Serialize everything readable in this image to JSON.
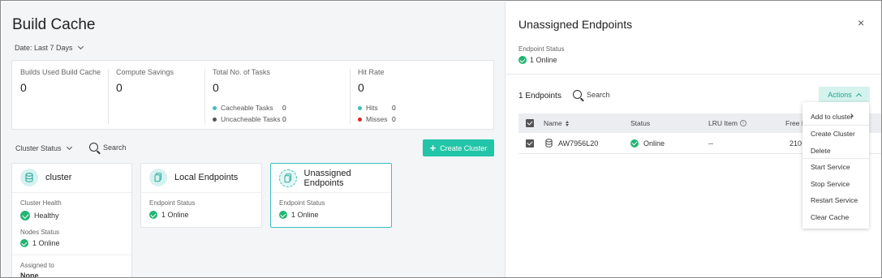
{
  "page": {
    "title": "Build Cache",
    "date_filter": "Date: Last 7 Days"
  },
  "stats": {
    "builds_used": {
      "label": "Builds Used Build Cache",
      "value": "0"
    },
    "compute_savings": {
      "label": "Compute Savings",
      "value": "0"
    },
    "total_tasks": {
      "label": "Total No. of Tasks",
      "value": "0",
      "cacheable_label": "Cacheable Tasks",
      "cacheable_value": "0",
      "uncacheable_label": "Uncacheable Tasks",
      "uncacheable_value": "0"
    },
    "hit_rate": {
      "label": "Hit Rate",
      "value": "0",
      "hits_label": "Hits",
      "hits_value": "0",
      "misses_label": "Misses",
      "misses_value": "0"
    }
  },
  "toolbar": {
    "cluster_status": "Cluster Status",
    "search": "Search",
    "create_cluster": "Create Cluster"
  },
  "tiles": {
    "cluster": {
      "title": "cluster",
      "health_label": "Cluster Health",
      "health_value": "Healthy",
      "nodes_label": "Nodes Status",
      "nodes_value": "1 Online",
      "assigned_label": "Assigned to",
      "assigned_value": "None"
    },
    "local": {
      "title": "Local Endpoints",
      "status_label": "Endpoint Status",
      "status_value": "1 Online"
    },
    "unassigned": {
      "title": "Unassigned Endpoints",
      "status_label": "Endpoint Status",
      "status_value": "1 Online"
    }
  },
  "panel": {
    "title": "Unassigned Endpoints",
    "close": "×",
    "status_label": "Endpoint Status",
    "status_value": "1 Online",
    "count": "1 Endpoints",
    "search": "Search",
    "actions": "Actions",
    "table": {
      "headers": {
        "name": "Name",
        "status": "Status",
        "lru": "LRU Item",
        "free": "Free D"
      },
      "rows": [
        {
          "name": "AW7956L20",
          "status": "Online",
          "lru": "--",
          "free": "210+"
        }
      ]
    }
  },
  "menu": {
    "items": [
      "Add to cluster",
      "Create Cluster",
      "Delete",
      "Start Service",
      "Stop Service",
      "Restart Service",
      "Clear Cache"
    ]
  },
  "colors": {
    "accent": "#22c5a8",
    "success": "#22b573",
    "cacheable_dot": "#3fbfbf",
    "uncacheable_dot": "#555555",
    "hits_dot": "#3fbfbf",
    "misses_dot": "#e02424"
  }
}
